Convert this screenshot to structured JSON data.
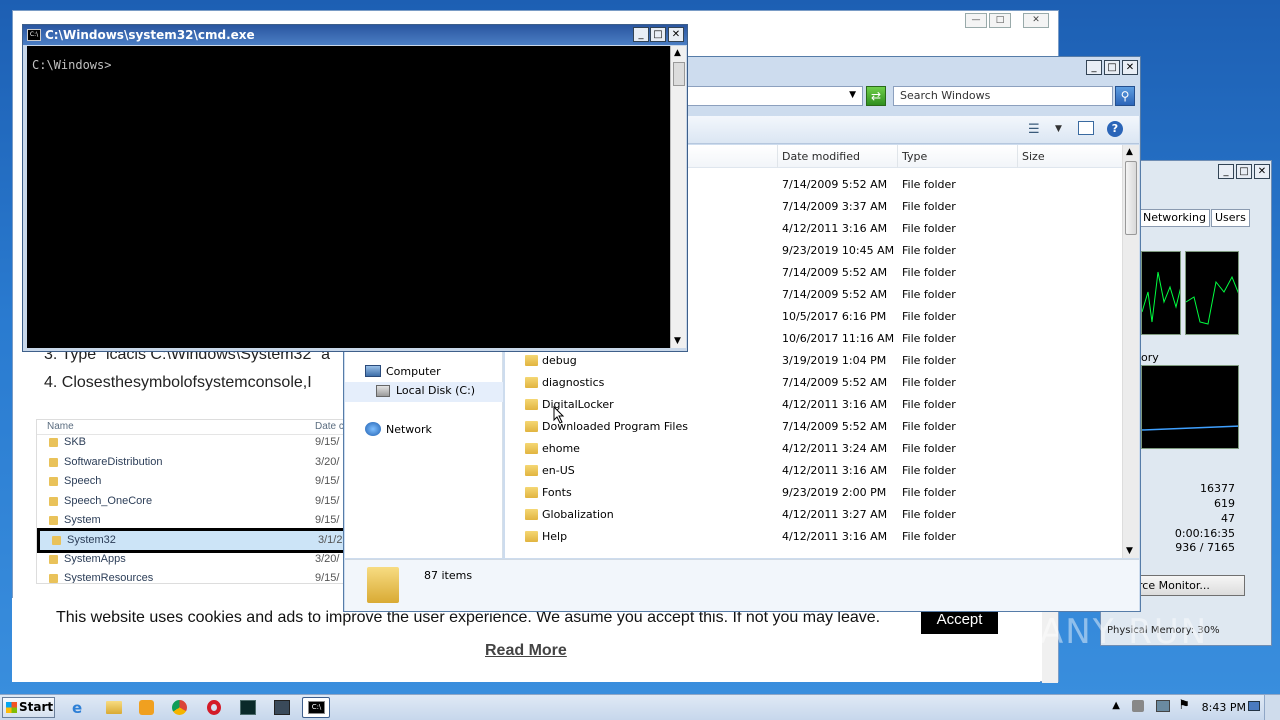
{
  "browser": {
    "steps": [
      "3. Type “icacls C:\\Windows\\System32” a",
      "4. Closesthesymbolofsystemconsole,I"
    ],
    "screenshot": {
      "header_name": "Name",
      "header_date": "Date c",
      "rows": [
        {
          "name": "SKB",
          "date": "9/15/"
        },
        {
          "name": "SoftwareDistribution",
          "date": "3/20/"
        },
        {
          "name": "Speech",
          "date": "9/15/"
        },
        {
          "name": "Speech_OneCore",
          "date": "9/15/"
        },
        {
          "name": "System",
          "date": "9/15/"
        },
        {
          "name": "System32",
          "date": "3/1/2"
        },
        {
          "name": "SystemApps",
          "date": "3/20/"
        },
        {
          "name": "SystemResources",
          "date": "9/15/"
        }
      ]
    },
    "cookie": {
      "text": "This website uses cookies and ads to improve the user experience. We asume you accept this. If not you may leave.",
      "accept": "Accept",
      "read_more": "Read More"
    }
  },
  "cmd": {
    "title": "C:\\Windows\\system32\\cmd.exe",
    "icon_text": "C:\\",
    "prompt": "C:\\Windows>"
  },
  "explorer": {
    "search_placeholder": "Search Windows",
    "columns": {
      "date": "Date modified",
      "type": "Type",
      "size": "Size"
    },
    "nav": {
      "computer": "Computer",
      "local_disk": "Local Disk (C:)",
      "network": "Network"
    },
    "rows": [
      {
        "name": "",
        "date": "7/14/2009 5:52 AM",
        "type": "File folder"
      },
      {
        "name": "",
        "date": "7/14/2009 3:37 AM",
        "type": "File folder"
      },
      {
        "name": "",
        "date": "4/12/2011 3:16 AM",
        "type": "File folder"
      },
      {
        "name": "",
        "date": "9/23/2019 10:45 AM",
        "type": "File folder"
      },
      {
        "name": "",
        "date": "7/14/2009 5:52 AM",
        "type": "File folder"
      },
      {
        "name": "",
        "date": "7/14/2009 5:52 AM",
        "type": "File folder"
      },
      {
        "name": "",
        "date": "10/5/2017 6:16 PM",
        "type": "File folder"
      },
      {
        "name": "",
        "date": "10/6/2017 11:16 AM",
        "type": "File folder"
      },
      {
        "name": "debug",
        "date": "3/19/2019 1:04 PM",
        "type": "File folder"
      },
      {
        "name": "diagnostics",
        "date": "7/14/2009 5:52 AM",
        "type": "File folder"
      },
      {
        "name": "DigitalLocker",
        "date": "4/12/2011 3:16 AM",
        "type": "File folder"
      },
      {
        "name": "Downloaded Program Files",
        "date": "7/14/2009 5:52 AM",
        "type": "File folder"
      },
      {
        "name": "ehome",
        "date": "4/12/2011 3:24 AM",
        "type": "File folder"
      },
      {
        "name": "en-US",
        "date": "4/12/2011 3:16 AM",
        "type": "File folder"
      },
      {
        "name": "Fonts",
        "date": "9/23/2019 2:00 PM",
        "type": "File folder"
      },
      {
        "name": "Globalization",
        "date": "4/12/2011 3:27 AM",
        "type": "File folder"
      },
      {
        "name": "Help",
        "date": "4/12/2011 3:16 AM",
        "type": "File folder"
      }
    ],
    "status": "87 items"
  },
  "taskmgr": {
    "tabs": [
      "Networking",
      "Users"
    ],
    "memory_label": "ory",
    "stats": [
      "16377",
      "619",
      "47",
      "0:00:16:35",
      "936 / 7165"
    ],
    "resource_button": "rce Monitor...",
    "physical_memory": "Physical Memory: 30%"
  },
  "taskbar": {
    "start": "Start",
    "clock": "8:43 PM"
  },
  "watermark": "ANY RUN"
}
